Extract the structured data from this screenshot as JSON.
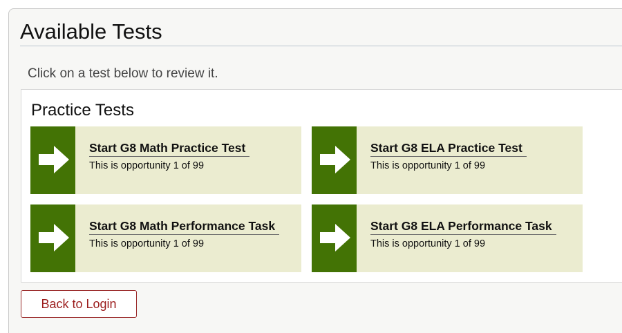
{
  "page": {
    "title": "Available Tests",
    "instructions": "Click on a test below to review it."
  },
  "practice_tests": {
    "section_title": "Practice Tests",
    "tests": [
      {
        "name": "Start G8 Math Practice Test",
        "opportunity": "This is opportunity 1 of 99",
        "icon": "arrow-right-icon"
      },
      {
        "name": "Start G8 ELA Practice Test",
        "opportunity": "This is opportunity 1 of 99",
        "icon": "arrow-right-icon"
      },
      {
        "name": "Start G8 Math Performance Task",
        "opportunity": "This is opportunity 1 of 99",
        "icon": "arrow-right-icon"
      },
      {
        "name": "Start G8 ELA Performance Task",
        "opportunity": "This is opportunity 1 of 99",
        "icon": "arrow-right-icon"
      }
    ]
  },
  "actions": {
    "back_label": "Back to Login"
  },
  "colors": {
    "card_background": "#ebecd0",
    "arrow_background": "#437305",
    "back_button_text": "#9b1c1c",
    "back_button_border": "#9b2c2c"
  }
}
